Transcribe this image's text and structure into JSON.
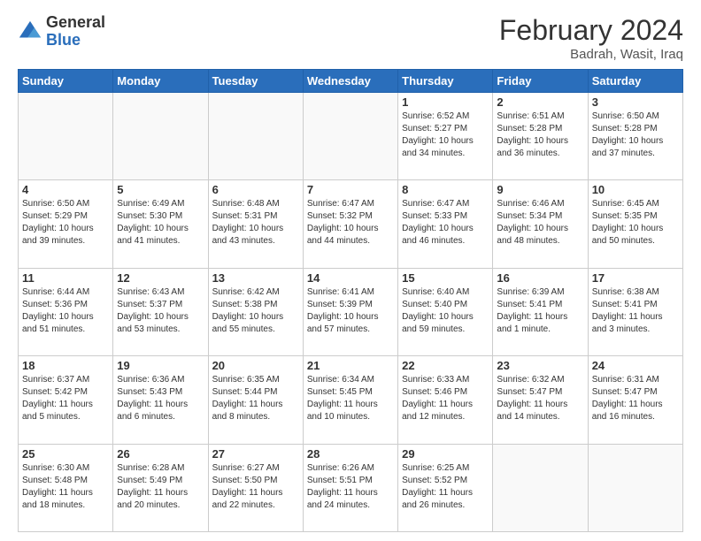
{
  "logo": {
    "general": "General",
    "blue": "Blue"
  },
  "title": {
    "month_year": "February 2024",
    "location": "Badrah, Wasit, Iraq"
  },
  "days_of_week": [
    "Sunday",
    "Monday",
    "Tuesday",
    "Wednesday",
    "Thursday",
    "Friday",
    "Saturday"
  ],
  "weeks": [
    [
      {
        "day": "",
        "info": ""
      },
      {
        "day": "",
        "info": ""
      },
      {
        "day": "",
        "info": ""
      },
      {
        "day": "",
        "info": ""
      },
      {
        "day": "1",
        "info": "Sunrise: 6:52 AM\nSunset: 5:27 PM\nDaylight: 10 hours\nand 34 minutes."
      },
      {
        "day": "2",
        "info": "Sunrise: 6:51 AM\nSunset: 5:28 PM\nDaylight: 10 hours\nand 36 minutes."
      },
      {
        "day": "3",
        "info": "Sunrise: 6:50 AM\nSunset: 5:28 PM\nDaylight: 10 hours\nand 37 minutes."
      }
    ],
    [
      {
        "day": "4",
        "info": "Sunrise: 6:50 AM\nSunset: 5:29 PM\nDaylight: 10 hours\nand 39 minutes."
      },
      {
        "day": "5",
        "info": "Sunrise: 6:49 AM\nSunset: 5:30 PM\nDaylight: 10 hours\nand 41 minutes."
      },
      {
        "day": "6",
        "info": "Sunrise: 6:48 AM\nSunset: 5:31 PM\nDaylight: 10 hours\nand 43 minutes."
      },
      {
        "day": "7",
        "info": "Sunrise: 6:47 AM\nSunset: 5:32 PM\nDaylight: 10 hours\nand 44 minutes."
      },
      {
        "day": "8",
        "info": "Sunrise: 6:47 AM\nSunset: 5:33 PM\nDaylight: 10 hours\nand 46 minutes."
      },
      {
        "day": "9",
        "info": "Sunrise: 6:46 AM\nSunset: 5:34 PM\nDaylight: 10 hours\nand 48 minutes."
      },
      {
        "day": "10",
        "info": "Sunrise: 6:45 AM\nSunset: 5:35 PM\nDaylight: 10 hours\nand 50 minutes."
      }
    ],
    [
      {
        "day": "11",
        "info": "Sunrise: 6:44 AM\nSunset: 5:36 PM\nDaylight: 10 hours\nand 51 minutes."
      },
      {
        "day": "12",
        "info": "Sunrise: 6:43 AM\nSunset: 5:37 PM\nDaylight: 10 hours\nand 53 minutes."
      },
      {
        "day": "13",
        "info": "Sunrise: 6:42 AM\nSunset: 5:38 PM\nDaylight: 10 hours\nand 55 minutes."
      },
      {
        "day": "14",
        "info": "Sunrise: 6:41 AM\nSunset: 5:39 PM\nDaylight: 10 hours\nand 57 minutes."
      },
      {
        "day": "15",
        "info": "Sunrise: 6:40 AM\nSunset: 5:40 PM\nDaylight: 10 hours\nand 59 minutes."
      },
      {
        "day": "16",
        "info": "Sunrise: 6:39 AM\nSunset: 5:41 PM\nDaylight: 11 hours\nand 1 minute."
      },
      {
        "day": "17",
        "info": "Sunrise: 6:38 AM\nSunset: 5:41 PM\nDaylight: 11 hours\nand 3 minutes."
      }
    ],
    [
      {
        "day": "18",
        "info": "Sunrise: 6:37 AM\nSunset: 5:42 PM\nDaylight: 11 hours\nand 5 minutes."
      },
      {
        "day": "19",
        "info": "Sunrise: 6:36 AM\nSunset: 5:43 PM\nDaylight: 11 hours\nand 6 minutes."
      },
      {
        "day": "20",
        "info": "Sunrise: 6:35 AM\nSunset: 5:44 PM\nDaylight: 11 hours\nand 8 minutes."
      },
      {
        "day": "21",
        "info": "Sunrise: 6:34 AM\nSunset: 5:45 PM\nDaylight: 11 hours\nand 10 minutes."
      },
      {
        "day": "22",
        "info": "Sunrise: 6:33 AM\nSunset: 5:46 PM\nDaylight: 11 hours\nand 12 minutes."
      },
      {
        "day": "23",
        "info": "Sunrise: 6:32 AM\nSunset: 5:47 PM\nDaylight: 11 hours\nand 14 minutes."
      },
      {
        "day": "24",
        "info": "Sunrise: 6:31 AM\nSunset: 5:47 PM\nDaylight: 11 hours\nand 16 minutes."
      }
    ],
    [
      {
        "day": "25",
        "info": "Sunrise: 6:30 AM\nSunset: 5:48 PM\nDaylight: 11 hours\nand 18 minutes."
      },
      {
        "day": "26",
        "info": "Sunrise: 6:28 AM\nSunset: 5:49 PM\nDaylight: 11 hours\nand 20 minutes."
      },
      {
        "day": "27",
        "info": "Sunrise: 6:27 AM\nSunset: 5:50 PM\nDaylight: 11 hours\nand 22 minutes."
      },
      {
        "day": "28",
        "info": "Sunrise: 6:26 AM\nSunset: 5:51 PM\nDaylight: 11 hours\nand 24 minutes."
      },
      {
        "day": "29",
        "info": "Sunrise: 6:25 AM\nSunset: 5:52 PM\nDaylight: 11 hours\nand 26 minutes."
      },
      {
        "day": "",
        "info": ""
      },
      {
        "day": "",
        "info": ""
      }
    ]
  ]
}
